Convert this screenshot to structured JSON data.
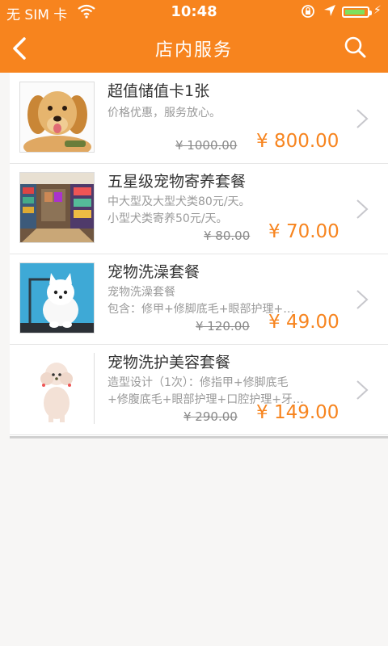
{
  "status": {
    "carrier": "无 SIM 卡",
    "time": "10:48"
  },
  "header": {
    "title": "店内服务"
  },
  "items": [
    {
      "name": "超值储值卡1张",
      "desc1": "价格优惠，服务放心。",
      "desc2": "",
      "old_price": "¥ 1000.00",
      "price": "¥ 800.00"
    },
    {
      "name": "五星级宠物寄养套餐",
      "desc1": "中大型及大型犬类80元/天。",
      "desc2": "小型犬类寄养50元/天。",
      "old_price": "¥ 80.00",
      "price": "¥ 70.00"
    },
    {
      "name": "宠物洗澡套餐",
      "desc1": "宠物洗澡套餐",
      "desc2": "包含：修甲+修脚底毛+眼部护理+…",
      "old_price": "¥ 120.00",
      "price": "¥ 49.00"
    },
    {
      "name": "宠物洗护美容套餐",
      "desc1": "造型设计（1次）：修指甲+修脚底毛",
      "desc2": "+修腹底毛+眼部护理+口腔护理+牙…",
      "old_price": "¥ 290.00",
      "price": "¥ 149.00"
    }
  ],
  "colors": {
    "accent": "#f7841e",
    "background": "#f7f6f5"
  },
  "icons": {
    "back": "chevron-left-icon",
    "search": "search-icon",
    "row": "chevron-right-icon"
  }
}
